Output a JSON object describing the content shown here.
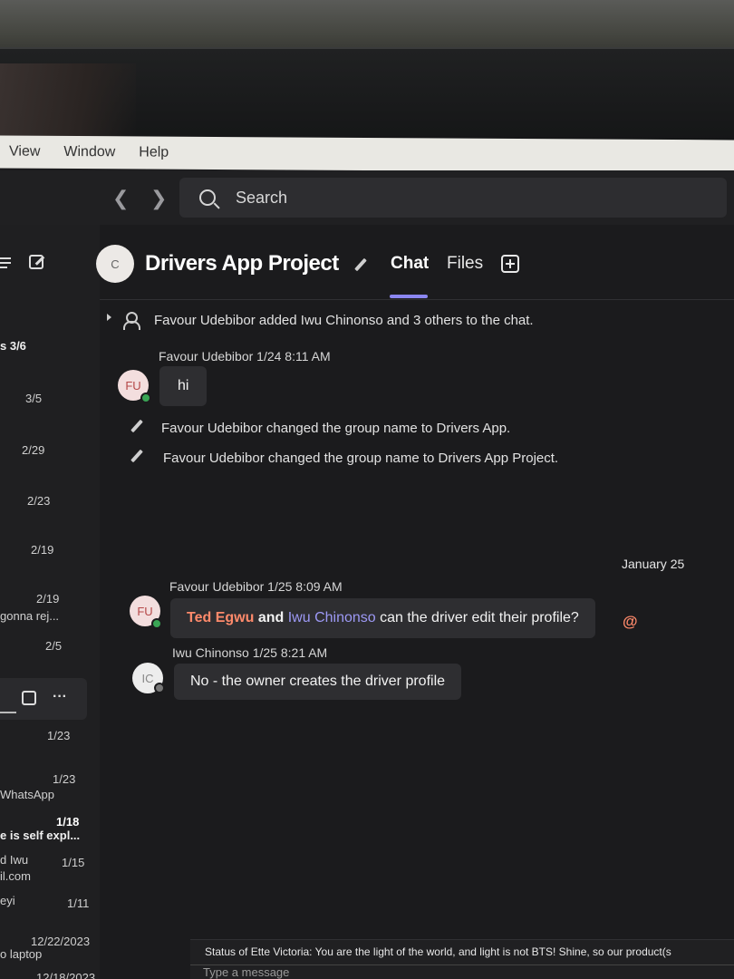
{
  "menubar": {
    "items": [
      "View",
      "Window",
      "Help"
    ]
  },
  "search": {
    "placeholder": "Search"
  },
  "left": {
    "items": [
      {
        "text": "s  3/6"
      },
      {
        "text": "3/5"
      },
      {
        "text": "2/29"
      },
      {
        "text": "2/23"
      },
      {
        "text": "2/19"
      },
      {
        "text": "2/19"
      },
      {
        "text": "gonna rej..."
      },
      {
        "text": "2/5"
      },
      {
        "text": "1/23"
      },
      {
        "text": "1/23"
      },
      {
        "text": "WhatsApp"
      },
      {
        "text": "1/18"
      },
      {
        "text": "e is self expl..."
      },
      {
        "text": "d Iwu"
      },
      {
        "text": "1/15"
      },
      {
        "text": "il.com"
      },
      {
        "text": "eyi"
      },
      {
        "text": "1/11"
      },
      {
        "text": "12/22/2023"
      },
      {
        "text": "o laptop"
      },
      {
        "text": "12/18/2023"
      }
    ],
    "toolbar_more": "···"
  },
  "chat": {
    "avatar_initial": "C",
    "title": "Drivers App Project",
    "tabs": {
      "chat": "Chat",
      "files": "Files"
    },
    "system_added": "Favour Udebibor added Iwu Chinonso and 3 others to the chat.",
    "msg1": {
      "author_time": "Favour Udebibor  1/24 8:11 AM",
      "initials": "FU",
      "text": "hi"
    },
    "rename1": "Favour Udebibor changed the group name to Drivers App.",
    "rename2": "Favour Udebibor changed the group name to Drivers App Project.",
    "date_separator": "January 25",
    "msg2": {
      "author_time": "Favour Udebibor  1/25 8:09 AM",
      "initials": "FU",
      "mention1": "Ted Egwu",
      "and": " and ",
      "mention2": "Iwu Chinonso",
      "text": " can the driver edit their profile?",
      "at": "@"
    },
    "msg3": {
      "author_time": "Iwu Chinonso  1/25 8:21 AM",
      "initials": "IC",
      "text": "No - the owner creates the driver profile"
    },
    "status": "Status of Ette Victoria: You are the light of the world, and light is not BTS! Shine, so our product(s",
    "compose_placeholder": "Type a message"
  },
  "colors": {
    "accent": "#8b86f0",
    "mention": "#ff8a6b",
    "presence": "#3aa555"
  }
}
